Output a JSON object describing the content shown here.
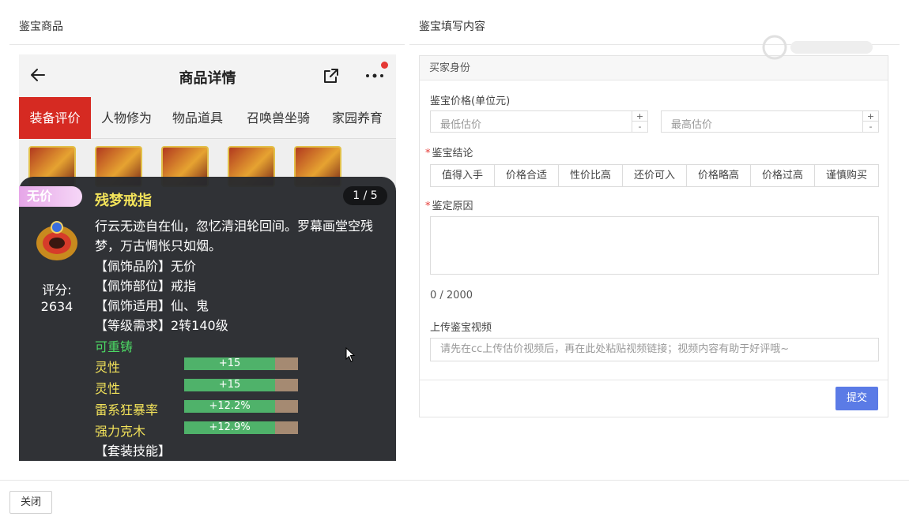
{
  "left": {
    "title": "鉴宝商品"
  },
  "right": {
    "title": "鉴宝填写内容"
  },
  "phone": {
    "title": "商品详情",
    "tabs": [
      "装备评价",
      "人物修为",
      "物品道具",
      "召唤兽坐骑",
      "家园养育"
    ]
  },
  "tooltip": {
    "badge": "无价",
    "name": "残梦戒指",
    "page": "1 / 5",
    "desc": "行云无迹自在仙，忽忆清泪轮回间。罗幕画堂空残梦，万古惆怅只如烟。",
    "lines": [
      "【佩饰品阶】无价",
      "【佩饰部位】戒指",
      "【佩饰适用】仙、鬼",
      "【等级需求】2转140级"
    ],
    "score_label": "评分:",
    "score_value": "2634",
    "recast": "可重铸",
    "attrs": [
      {
        "name": "灵性",
        "value": "+15",
        "fill": 0.8
      },
      {
        "name": "灵性",
        "value": "+15",
        "fill": 0.8
      },
      {
        "name": "雷系狂暴率",
        "value": "+12.2%",
        "fill": 0.8
      },
      {
        "name": "强力克木",
        "value": "+12.9%",
        "fill": 0.8
      }
    ],
    "set_skill": "【套装技能】"
  },
  "form": {
    "section": "买家身份",
    "price_label": "鉴宝价格(单位元)",
    "min_placeholder": "最低估价",
    "max_placeholder": "最高估价",
    "spin_up": "+",
    "spin_down": "-",
    "conclusion_label": "鉴宝结论",
    "conclusion_options": [
      "值得入手",
      "价格合适",
      "性价比高",
      "还价可入",
      "价格略高",
      "价格过高",
      "谨慎购买"
    ],
    "reason_label": "鉴定原因",
    "counter": "0 / 2000",
    "video_label": "上传鉴宝视频",
    "video_placeholder": "请先在cc上传估价视频后，再在此处粘贴视频链接；视频内容有助于好评哦~",
    "required_mark": "*",
    "submit": "提交"
  },
  "footer": {
    "close": "关闭"
  },
  "colors": {
    "accent": "#5b7be6",
    "tab_active": "#d62a22",
    "attr_name": "#f3e35a",
    "recast": "#4cd964"
  }
}
